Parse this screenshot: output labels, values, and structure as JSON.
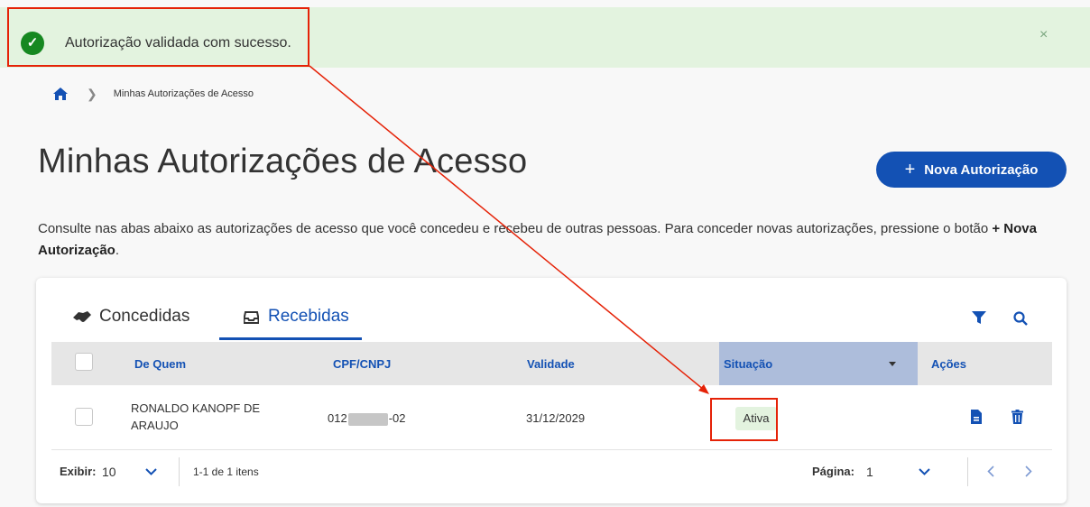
{
  "alert": {
    "message": "Autorização validada com sucesso.",
    "close": "×"
  },
  "breadcrumb": {
    "current": "Minhas Autorizações de Acesso"
  },
  "page": {
    "title": "Minhas Autorizações de Acesso",
    "new_button": "Nova Autorização",
    "description": "Consulte nas abas abaixo as autorizações de acesso que você concedeu e recebeu de outras pessoas. Para conceder novas autorizações, pressione o botão",
    "description_button": "Nova Autorização"
  },
  "tabs": [
    {
      "label": "Concedidas"
    },
    {
      "label": "Recebidas"
    }
  ],
  "table": {
    "headers": {
      "from": "De Quem",
      "cpf": "CPF/CNPJ",
      "validity": "Validade",
      "status": "Situação",
      "actions": "Ações"
    },
    "rows": [
      {
        "name": "RONALDO KANOPF DE ARAUJO",
        "cpf_prefix": "012",
        "cpf_suffix": "-02",
        "validity": "31/12/2029",
        "status": "Ativa"
      }
    ]
  },
  "pagination": {
    "show_label": "Exibir:",
    "per_page": "10",
    "range": "1-1 de 1 itens",
    "page_label": "Página:",
    "page": "1"
  },
  "colors": {
    "primary": "#1351b4",
    "success": "#168821",
    "alert_bg": "#e3f3df",
    "highlight": "#e52207"
  }
}
